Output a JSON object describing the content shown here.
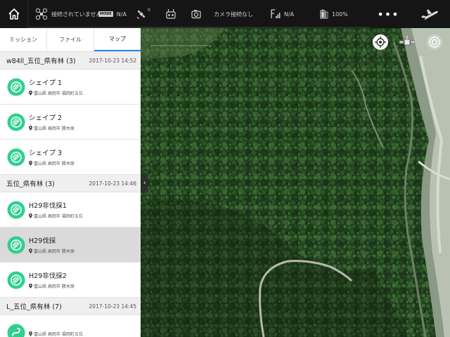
{
  "topbar": {
    "connection_status": "接続されていません",
    "mode_badge": "MODE",
    "mode_value": "N/A",
    "gps_count": "0",
    "camera_status": "カメラ接続なし",
    "signal_value": "N/A",
    "battery": "100%",
    "more_label": "•••"
  },
  "tabs": [
    {
      "label": "ミッション"
    },
    {
      "label": "ファイル"
    },
    {
      "label": "マップ"
    }
  ],
  "groups": [
    {
      "title": "w84ll_五位_県有林 (3)",
      "date": "2017-10-23 14:52",
      "items": [
        {
          "name": "シェイプ 1",
          "location": "富山県 高岡市 福岡町五位"
        },
        {
          "name": "シェイプ 2",
          "location": "富山県 高岡市 勝木原"
        },
        {
          "name": "シェイプ 3",
          "location": "富山県 高岡市 勝木原"
        }
      ]
    },
    {
      "title": "五位_県有林 (3)",
      "date": "2017-10-23 14:46",
      "items": [
        {
          "name": "H29非伐採1",
          "location": "富山県 高岡市 福岡町五位"
        },
        {
          "name": "H29伐採",
          "location": "富山県 高岡市 勝木原"
        },
        {
          "name": "H29非伐採2",
          "location": "富山県 高岡市 勝木原"
        }
      ]
    },
    {
      "title": "L_五位_県有林 (7)",
      "date": "2017-10-23 14:45",
      "items": [
        {
          "name": "",
          "location": "富山県 高岡市 福岡町五位"
        }
      ]
    }
  ],
  "colors": {
    "accent": "#1f8cf0",
    "mission_icon": "#2fd08f",
    "topbar": "#151515",
    "selected_row": "#dadada"
  },
  "icons": {
    "home": "home-icon",
    "drone": "drone-icon",
    "gps": "satellite-gps-icon",
    "remote": "remote-controller-icon",
    "camera": "camera-icon",
    "signal": "signal-strength-icon",
    "battery": "battery-icon",
    "plane": "takeoff-plane-icon",
    "locate": "locate-icon",
    "satellite_map": "satellite-map-icon",
    "compass": "compass-icon"
  }
}
